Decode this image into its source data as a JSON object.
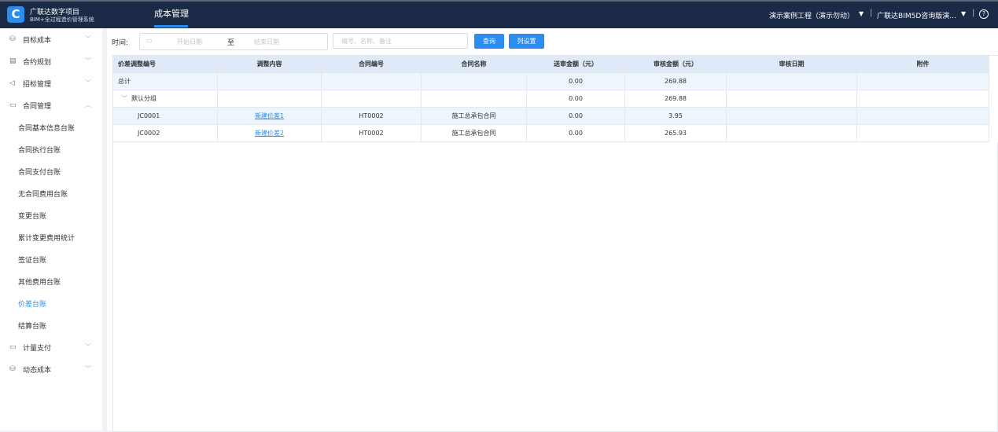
{
  "header": {
    "brand_line1": "广联达数字项目",
    "brand_line2": "BIM+全过程造价管理系统",
    "logo_letter": "C",
    "nav_tab": "成本管理",
    "project": "演示案例工程（演示勿动）",
    "company": "广联达BIM5D咨询版演...",
    "separator": "|",
    "help": "?"
  },
  "sidebar": {
    "menus": [
      {
        "label": "目标成本",
        "icon": "database-icon"
      },
      {
        "label": "合约规划",
        "icon": "document-icon"
      },
      {
        "label": "招标管理",
        "icon": "send-icon"
      },
      {
        "label": "合同管理",
        "icon": "briefcase-icon",
        "expanded": true
      }
    ],
    "contract_items": [
      "合同基本信息台账",
      "合同执行台账",
      "合同支付台账",
      "无合同费用台账",
      "变更台账",
      "累计变更费用统计",
      "签证台账",
      "其他费用台账",
      "价差台账",
      "结算台账"
    ],
    "active_item": "价差台账",
    "bottom_menus": [
      {
        "label": "计量支付",
        "icon": "briefcase-icon"
      },
      {
        "label": "动态成本",
        "icon": "database-icon"
      }
    ]
  },
  "filters": {
    "time_label": "时间:",
    "start_placeholder": "开始日期",
    "to_label": "至",
    "end_placeholder": "结束日期",
    "keyword_placeholder": "编号、名称、备注",
    "query_button": "查询",
    "columns_button": "列设置"
  },
  "table": {
    "headers": [
      "价差调整编号",
      "调整内容",
      "合同编号",
      "合同名称",
      "送审金额（元）",
      "审核金额（元）",
      "审核日期",
      "附件"
    ],
    "total": {
      "label": "总计",
      "submitted": "0.00",
      "approved": "269.88"
    },
    "group": {
      "label": "默认分组",
      "submitted": "0.00",
      "approved": "269.88"
    },
    "rows": [
      {
        "code": "JC0001",
        "content": "新建价差1",
        "contract_no": "HT0002",
        "contract_name": "施工总承包合同",
        "submitted": "0.00",
        "approved": "3.95",
        "date": "",
        "attachment": ""
      },
      {
        "code": "JC0002",
        "content": "新建价差2",
        "contract_no": "HT0002",
        "contract_name": "施工总承包合同",
        "submitted": "0.00",
        "approved": "265.93",
        "date": "",
        "attachment": ""
      }
    ]
  },
  "colors": {
    "topbar": "#1b2a46",
    "accent": "#2d8cf0",
    "header_row": "#deeaf7",
    "tint_row": "#eef6fd"
  }
}
